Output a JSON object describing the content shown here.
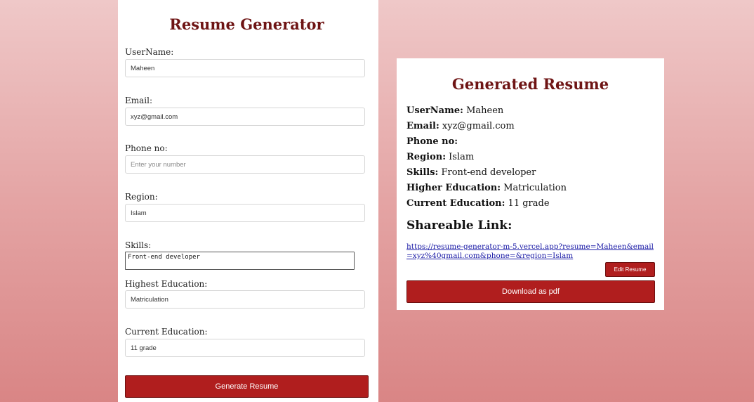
{
  "form": {
    "title": "Resume Generator",
    "fields": [
      {
        "label": "UserName:",
        "value": "Maheen",
        "placeholder": ""
      },
      {
        "label": "Email:",
        "value": "xyz@gmail.com",
        "placeholder": ""
      },
      {
        "label": "Phone no:",
        "value": "",
        "placeholder": "Enter your number"
      },
      {
        "label": "Region:",
        "value": "Islam",
        "placeholder": ""
      },
      {
        "label": "Skills:",
        "value": "Front-end developer",
        "placeholder": ""
      },
      {
        "label": "Highest Education:",
        "value": "Matriculation",
        "placeholder": ""
      },
      {
        "label": "Current Education:",
        "value": "11 grade",
        "placeholder": ""
      }
    ],
    "submit_label": "Generate Resume"
  },
  "resume": {
    "title": "Generated Resume",
    "lines": [
      {
        "key": "UserName:",
        "value": "Maheen"
      },
      {
        "key": "Email:",
        "value": "xyz@gmail.com"
      },
      {
        "key": "Phone no:",
        "value": ""
      },
      {
        "key": "Region:",
        "value": "Islam"
      },
      {
        "key": "Skills:",
        "value": "Front-end developer"
      },
      {
        "key": "Higher Education:",
        "value": "Matriculation"
      },
      {
        "key": "Current Education:",
        "value": "11 grade"
      }
    ],
    "share_heading": "Shareable Link:",
    "share_url": "https://resume-generator-m-5.vercel.app?resume=Maheen&email=xyz%40gmail.com&phone=&region=Islam",
    "edit_label": "Edit Resume",
    "download_label": "Download as pdf"
  }
}
